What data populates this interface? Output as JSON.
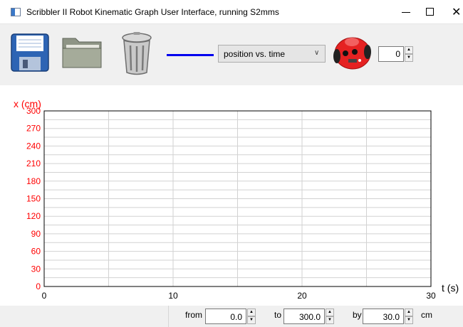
{
  "window": {
    "title": "Scribbler II Robot Kinematic Graph User Interface, running S2mms",
    "minimize_glyph": "—",
    "maximize_glyph": "☐",
    "close_glyph": "✕"
  },
  "toolbar": {
    "save_icon": "floppy-disk-icon",
    "open_icon": "folder-icon",
    "clear_icon": "trash-can-icon",
    "line_color": "#0000ee",
    "graph_type": {
      "selected": "position vs. time"
    },
    "robot_icon": "scribbler-robot-icon",
    "robot_number": "0"
  },
  "chart_data": {
    "type": "line",
    "xlabel": "t (s)",
    "ylabel": "x (cm)",
    "xlim": [
      0,
      30
    ],
    "ylim": [
      0,
      300
    ],
    "x_ticks": [
      "0",
      "10",
      "20",
      "30"
    ],
    "y_ticks": [
      "0",
      "30",
      "60",
      "90",
      "120",
      "150",
      "180",
      "210",
      "240",
      "270",
      "300"
    ],
    "series": [],
    "grid": true,
    "axis_label_color": "#ff0000"
  },
  "range_controls": {
    "from_label": "from",
    "from_value": "0.0",
    "to_label": "to",
    "to_value": "300.0",
    "by_label": "by",
    "by_value": "30.0",
    "unit": "cm"
  }
}
